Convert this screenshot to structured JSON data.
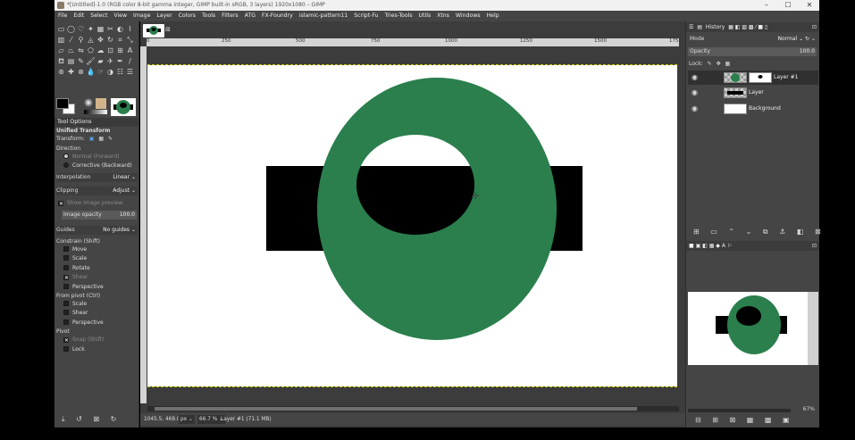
{
  "window": {
    "title": "*[Untitled]-1.0 (RGB color 8-bit gamma integer, GIMP built-in sRGB, 3 layers) 1920x1080 – GIMP",
    "minimize": "–",
    "maximize": "☐",
    "close": "✕"
  },
  "menu": [
    "File",
    "Edit",
    "Select",
    "View",
    "Image",
    "Layer",
    "Colors",
    "Tools",
    "Filters",
    "ATG",
    "FX-Foundry",
    "islamic-pattern11",
    "Script-Fu",
    "Tries-Tools",
    "Utils",
    "Xtns",
    "Windows",
    "Help"
  ],
  "tool_options": {
    "panel_title": "Tool Options",
    "tool_name": "Unified Transform",
    "transform_label": "Transform:",
    "direction_label": "Direction",
    "direction_options": [
      "Normal (Forward)",
      "Corrective (Backward)"
    ],
    "interpolation_label": "Interpolation",
    "interpolation_value": "Linear",
    "clipping_label": "Clipping",
    "clipping_value": "Adjust",
    "show_preview": "Show image preview",
    "image_opacity_label": "Image opacity",
    "image_opacity_value": "100.0",
    "guides_label": "Guides",
    "guides_value": "No guides",
    "constrain_label": "Constrain (Shift)",
    "constrain_items": [
      "Move",
      "Scale",
      "Rotate",
      "Shear",
      "Perspective"
    ],
    "from_pivot_label": "From pivot  (Ctrl)",
    "from_pivot_items": [
      "Scale",
      "Shear",
      "Perspective"
    ],
    "pivot_label": "Pivot",
    "pivot_items": [
      "Snap (Shift)",
      "Lock"
    ]
  },
  "ruler_labels": [
    "0",
    "250",
    "500",
    "750",
    "1000",
    "1250",
    "1500",
    "1750"
  ],
  "status": {
    "coords": "1045.5, 468.0",
    "unit": "px",
    "zoom": "66.7 %",
    "layer_info": "Layer #1 (71.1 MB)"
  },
  "layers_panel": {
    "tab_label": "History",
    "mode_label": "Mode",
    "mode_value": "Normal",
    "opacity_label": "Opacity",
    "opacity_value": "100.0",
    "lock_label": "Lock:",
    "layers": [
      {
        "name": "Layer #1",
        "selected": true
      },
      {
        "name": "Layer",
        "selected": false
      },
      {
        "name": "Background",
        "selected": false
      }
    ]
  },
  "navigation": {
    "zoom": "67%"
  },
  "colors": {
    "green": "#2a7f4d",
    "black": "#000000",
    "white": "#ffffff",
    "panel": "#454545"
  },
  "icons": {
    "visibility": "eye-icon",
    "new_layer": "new-layer-icon",
    "delete": "delete-icon"
  }
}
